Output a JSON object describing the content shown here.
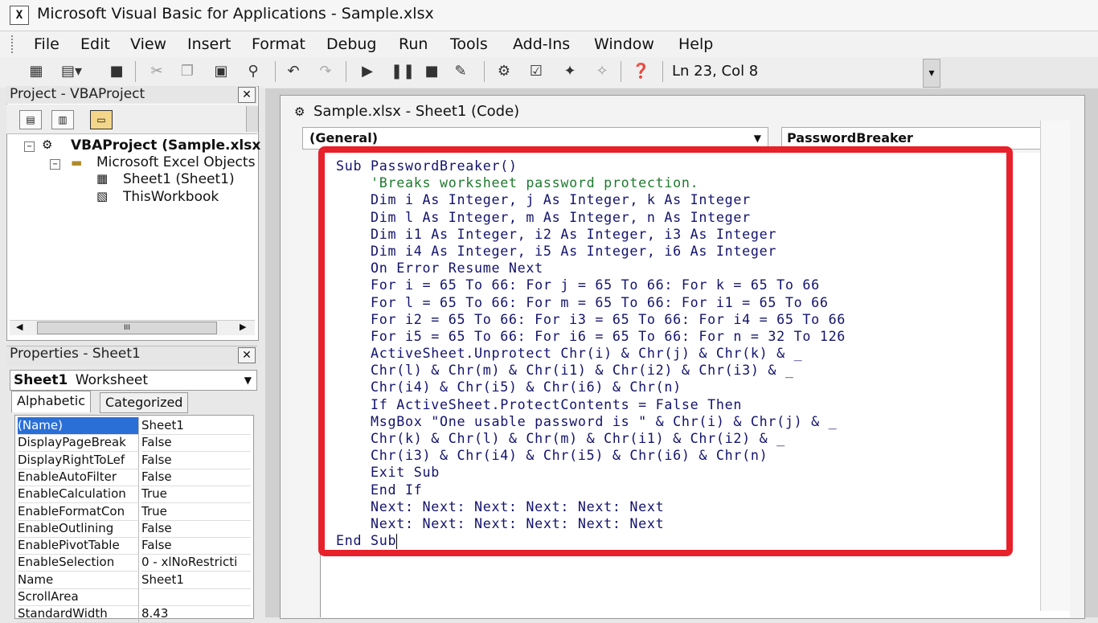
{
  "window": {
    "title": "Microsoft Visual Basic for Applications - Sample.xlsx"
  },
  "menu": [
    "File",
    "Edit",
    "View",
    "Insert",
    "Format",
    "Debug",
    "Run",
    "Tools",
    "Add-Ins",
    "Window",
    "Help"
  ],
  "toolbar": {
    "cursor_position": "Ln 23, Col 8"
  },
  "project": {
    "title": "Project - VBAProject",
    "tree": {
      "root": "VBAProject (Sample.xlsx",
      "folder": "Microsoft Excel Objects",
      "items": [
        "Sheet1 (Sheet1)",
        "ThisWorkbook"
      ]
    },
    "scroll_glyph": "III"
  },
  "properties": {
    "title": "Properties - Sheet1",
    "object_name": "Sheet1",
    "object_type": "Worksheet",
    "tabs": [
      "Alphabetic",
      "Categorized"
    ],
    "rows": [
      {
        "name": "(Name)",
        "value": "Sheet1"
      },
      {
        "name": "DisplayPageBreak",
        "value": "False"
      },
      {
        "name": "DisplayRightToLef",
        "value": "False"
      },
      {
        "name": "EnableAutoFilter",
        "value": "False"
      },
      {
        "name": "EnableCalculation",
        "value": "True"
      },
      {
        "name": "EnableFormatCon",
        "value": "True"
      },
      {
        "name": "EnableOutlining",
        "value": "False"
      },
      {
        "name": "EnablePivotTable",
        "value": "False"
      },
      {
        "name": "EnableSelection",
        "value": "0 - xlNoRestricti"
      },
      {
        "name": "Name",
        "value": "Sheet1"
      },
      {
        "name": "ScrollArea",
        "value": ""
      },
      {
        "name": "StandardWidth",
        "value": "8.43"
      }
    ]
  },
  "code_window": {
    "title": "Sample.xlsx - Sheet1 (Code)",
    "object_combo": "(General)",
    "procedure_combo": "PasswordBreaker",
    "lines": [
      {
        "text": "Sub PasswordBreaker()",
        "kind": "code"
      },
      {
        "text": "    'Breaks worksheet password protection.",
        "kind": "comment"
      },
      {
        "text": "    Dim i As Integer, j As Integer, k As Integer",
        "kind": "code"
      },
      {
        "text": "    Dim l As Integer, m As Integer, n As Integer",
        "kind": "code"
      },
      {
        "text": "    Dim i1 As Integer, i2 As Integer, i3 As Integer",
        "kind": "code"
      },
      {
        "text": "    Dim i4 As Integer, i5 As Integer, i6 As Integer",
        "kind": "code"
      },
      {
        "text": "    On Error Resume Next",
        "kind": "code"
      },
      {
        "text": "    For i = 65 To 66: For j = 65 To 66: For k = 65 To 66",
        "kind": "code"
      },
      {
        "text": "    For l = 65 To 66: For m = 65 To 66: For i1 = 65 To 66",
        "kind": "code"
      },
      {
        "text": "    For i2 = 65 To 66: For i3 = 65 To 66: For i4 = 65 To 66",
        "kind": "code"
      },
      {
        "text": "    For i5 = 65 To 66: For i6 = 65 To 66: For n = 32 To 126",
        "kind": "code"
      },
      {
        "text": "    ActiveSheet.Unprotect Chr(i) & Chr(j) & Chr(k) & _",
        "kind": "code"
      },
      {
        "text": "    Chr(l) & Chr(m) & Chr(i1) & Chr(i2) & Chr(i3) & _",
        "kind": "code"
      },
      {
        "text": "    Chr(i4) & Chr(i5) & Chr(i6) & Chr(n)",
        "kind": "code"
      },
      {
        "text": "    If ActiveSheet.ProtectContents = False Then",
        "kind": "code"
      },
      {
        "text": "    MsgBox \"One usable password is \" & Chr(i) & Chr(j) & _",
        "kind": "code"
      },
      {
        "text": "    Chr(k) & Chr(l) & Chr(m) & Chr(i1) & Chr(i2) & _",
        "kind": "code"
      },
      {
        "text": "    Chr(i3) & Chr(i4) & Chr(i5) & Chr(i6) & Chr(n)",
        "kind": "code"
      },
      {
        "text": "    Exit Sub",
        "kind": "code"
      },
      {
        "text": "    End If",
        "kind": "code"
      },
      {
        "text": "    Next: Next: Next: Next: Next: Next",
        "kind": "code"
      },
      {
        "text": "    Next: Next: Next: Next: Next: Next",
        "kind": "code"
      },
      {
        "text": "End Sub",
        "kind": "code"
      }
    ]
  },
  "colors": {
    "highlight_border": "#e8202a",
    "code_text": "#13136e",
    "comment_text": "#1f7a2e",
    "selected_row": "#2a6fd6"
  },
  "icons": [
    "excel-view-icon",
    "insert-module-icon",
    "save-icon",
    "cut-icon",
    "copy-icon",
    "paste-icon",
    "find-icon",
    "undo-icon",
    "redo-icon",
    "run-icon",
    "break-icon",
    "reset-icon",
    "design-mode-icon",
    "project-explorer-icon",
    "properties-icon",
    "object-browser-icon",
    "toolbox-icon",
    "help-icon"
  ]
}
